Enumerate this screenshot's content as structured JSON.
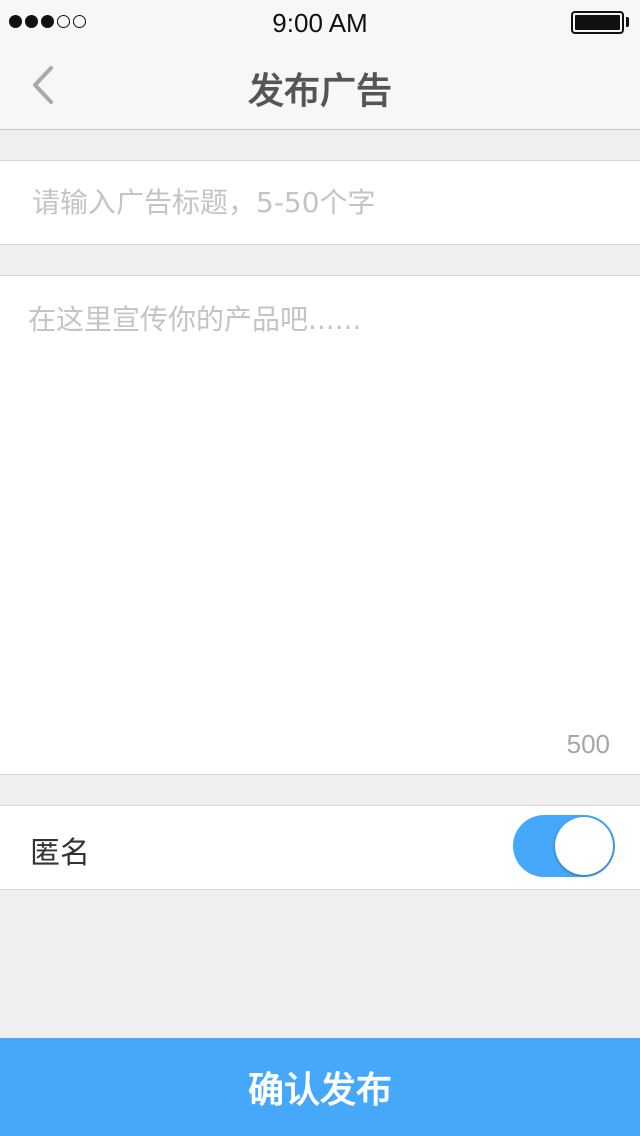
{
  "status_bar": {
    "signal_dots_filled": 3,
    "signal_dots_total": 5,
    "time": "9:00 AM",
    "battery_level": 1.0
  },
  "nav": {
    "back_icon": "chevron-left-icon",
    "title": "发布广告"
  },
  "form": {
    "title_placeholder": "请输入广告标题，5-50个字",
    "title_value": "",
    "content_placeholder": "在这里宣传你的产品吧......",
    "content_value": "",
    "char_counter": "500",
    "anonymous_label": "匿名",
    "anonymous_on": true
  },
  "confirm_button_label": "确认发布",
  "colors": {
    "accent": "#45a8fa",
    "background": "#efefef"
  }
}
